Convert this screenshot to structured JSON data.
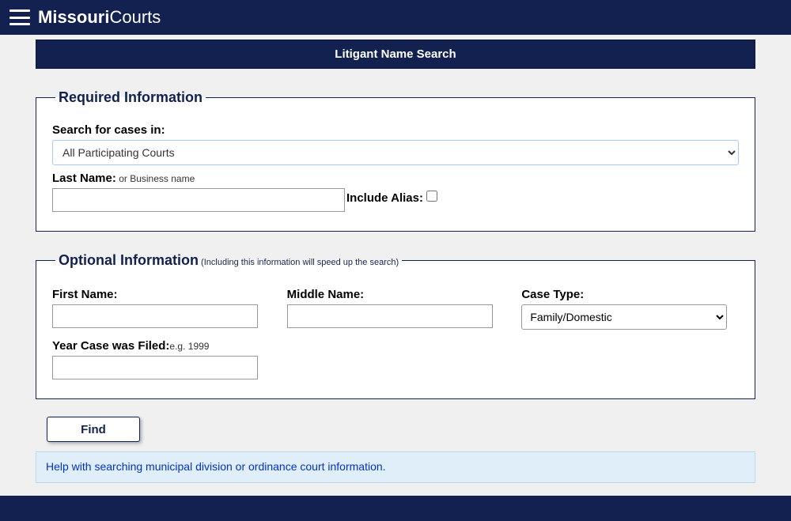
{
  "header": {
    "site_title_part1": "Missouri",
    "site_title_part2": "Courts"
  },
  "page_title": "Litigant Name Search",
  "required": {
    "legend": "Required Information",
    "search_label": "Search for cases in:",
    "court_selected": "All Participating Courts",
    "lastname_label": "Last Name:",
    "lastname_hint": " or Business name",
    "alias_label": "Include Alias:"
  },
  "optional": {
    "legend": "Optional Information",
    "legend_hint": " (Including this information will speed up the search)",
    "first_name_label": "First Name:",
    "middle_name_label": "Middle Name:",
    "case_type_label": "Case Type:",
    "case_type_selected": "Family/Domestic",
    "year_label": "Year Case was Filed:",
    "year_hint": "e.g. 1999"
  },
  "actions": {
    "find_label": "Find"
  },
  "help": {
    "link_text": "Help with searching municipal division or ordinance court information."
  }
}
